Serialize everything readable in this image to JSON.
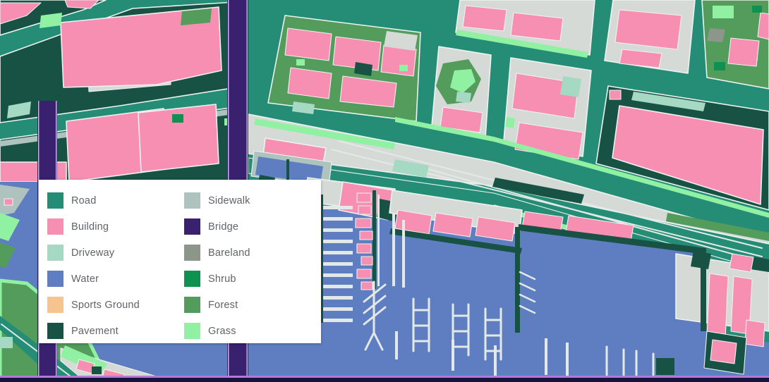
{
  "legend": {
    "items": [
      {
        "label": "Road",
        "color": "#258D76"
      },
      {
        "label": "Building",
        "color": "#F78FB2"
      },
      {
        "label": "Driveway",
        "color": "#A5D9C4"
      },
      {
        "label": "Water",
        "color": "#5F7EC2"
      },
      {
        "label": "Sports Ground",
        "color": "#F5C48F"
      },
      {
        "label": "Pavement",
        "color": "#175244"
      },
      {
        "label": "Sidewalk",
        "color": "#AFC3BE"
      },
      {
        "label": "Bridge",
        "color": "#39216F"
      },
      {
        "label": "Bareland",
        "color": "#8D968A"
      },
      {
        "label": "Shrub",
        "color": "#0F9150"
      },
      {
        "label": "Forest",
        "color": "#549C5C"
      },
      {
        "label": "Grass",
        "color": "#90F1A3"
      }
    ]
  },
  "palette": {
    "road": "#258D76",
    "building": "#F78FB2",
    "driveway": "#A5D9C4",
    "water": "#5F7EC2",
    "sportsground": "#F5C48F",
    "pavement": "#175244",
    "sidewalk": "#AFC3BE",
    "bridge": "#39216F",
    "bareland": "#8D968A",
    "shrub": "#0F9150",
    "forest": "#549C5C",
    "grass": "#90F1A3",
    "blockgray": "#D6DAD7",
    "outline": "#EDF3F0",
    "railline": "#E2E9E6",
    "bardark": "#14143F",
    "barline": "#B678D2"
  }
}
